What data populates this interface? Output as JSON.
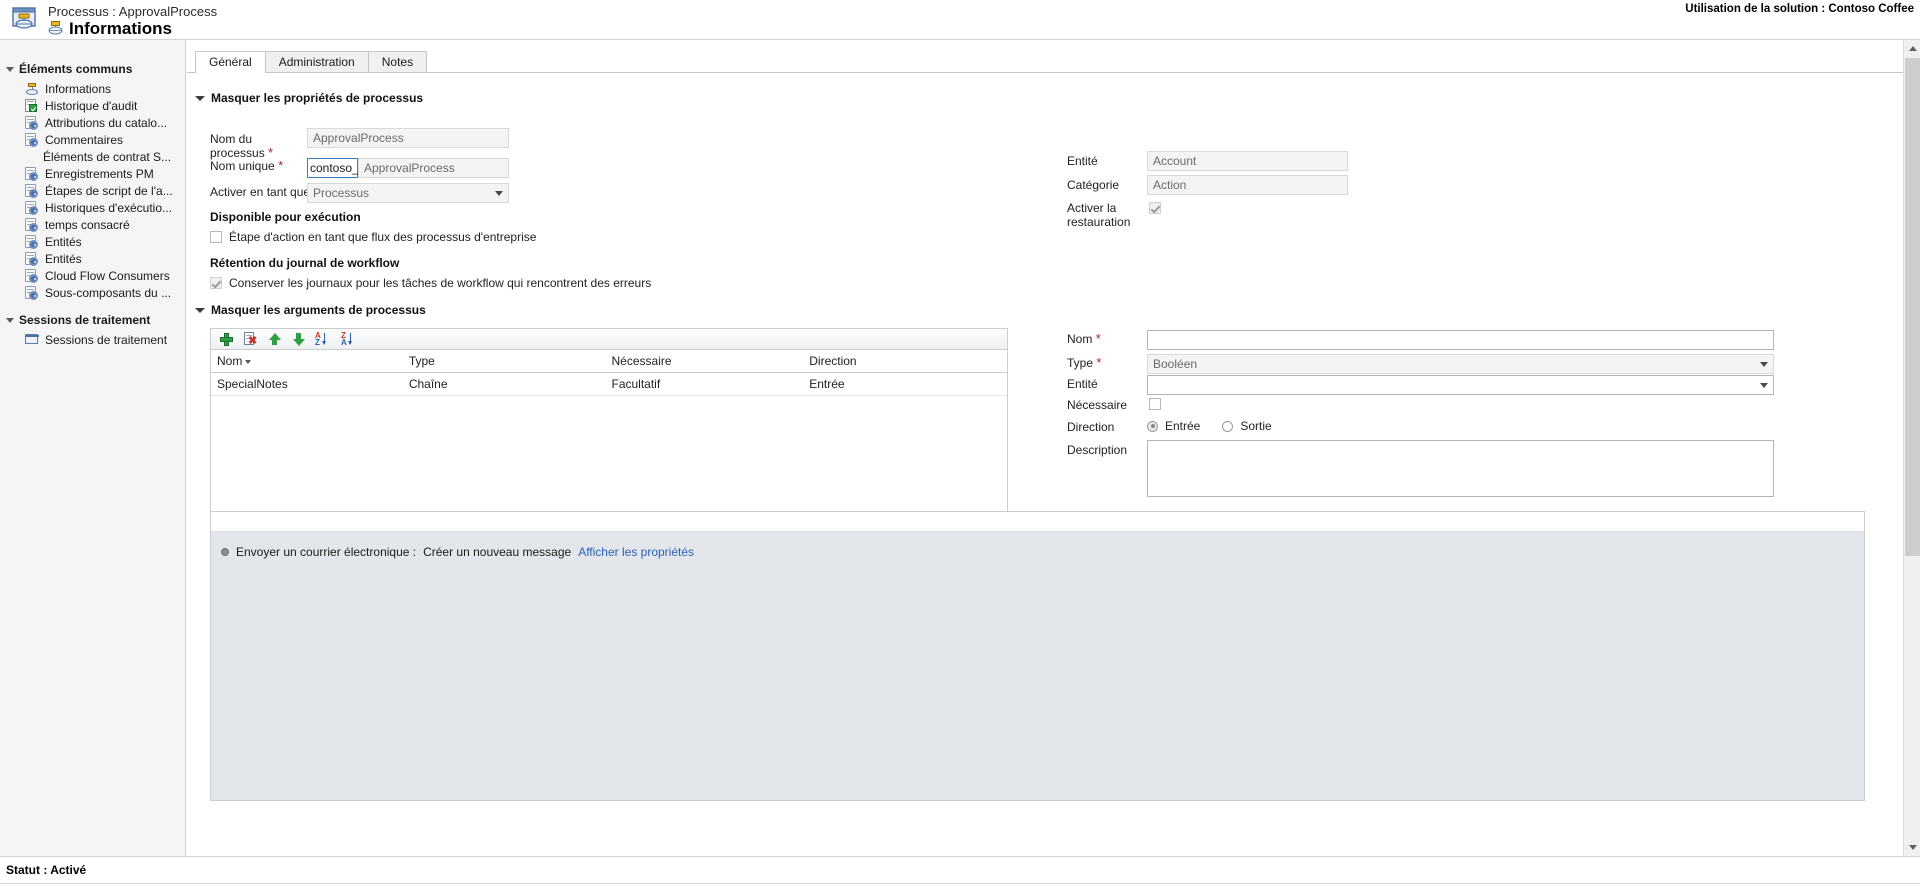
{
  "header": {
    "breadcrumb": "Processus : ApprovalProcess",
    "title": "Informations",
    "solution": "Utilisation de la solution : Contoso Coffee",
    "process_icon": "process-diagram-icon",
    "title_icon": "process-node-icon"
  },
  "sidebar": {
    "groups": [
      {
        "label": "Éléments communs",
        "items": [
          {
            "label": "Informations",
            "icon": "process-node-icon"
          },
          {
            "label": "Historique d'audit",
            "icon": "audit-history-icon"
          },
          {
            "label": "Attributions du catalo...",
            "icon": "component-gear-icon"
          },
          {
            "label": "Commentaires",
            "icon": "component-gear-icon"
          },
          {
            "label": "Éléments de contrat S...",
            "icon": "none"
          },
          {
            "label": "Enregistrements PM",
            "icon": "component-gear-icon"
          },
          {
            "label": "Étapes de script de l'a...",
            "icon": "component-gear-icon"
          },
          {
            "label": "Historiques d'exécutio...",
            "icon": "component-gear-icon"
          },
          {
            "label": "temps consacré",
            "icon": "component-gear-icon"
          },
          {
            "label": "Entités",
            "icon": "component-gear-icon"
          },
          {
            "label": "Entités",
            "icon": "component-gear-icon"
          },
          {
            "label": "Cloud Flow Consumers",
            "icon": "component-gear-icon"
          },
          {
            "label": "Sous-composants du ...",
            "icon": "component-gear-icon"
          }
        ]
      },
      {
        "label": "Sessions de traitement",
        "items": [
          {
            "label": "Sessions de traitement",
            "icon": "session-screen-icon"
          }
        ]
      }
    ]
  },
  "tabs": [
    {
      "label": "Général",
      "active": true
    },
    {
      "label": "Administration",
      "active": false
    },
    {
      "label": "Notes",
      "active": false
    }
  ],
  "properties_section": {
    "header": "Masquer les propriétés de processus",
    "fields": {
      "process_name_label": "Nom du processus",
      "process_name_value": "ApprovalProcess",
      "unique_name_label": "Nom unique",
      "unique_name_prefix": "contoso_",
      "unique_name_value": "ApprovalProcess",
      "activate_as_label": "Activer en tant que",
      "activate_as_value": "Processus",
      "entity_label": "Entité",
      "entity_value": "Account",
      "category_label": "Catégorie",
      "category_value": "Action",
      "rollback_label": "Activer la restauration",
      "rollback_checked": true
    },
    "available_for_run": {
      "header": "Disponible pour exécution",
      "checkbox_label": "Étape d'action en tant que flux des processus d'entreprise",
      "checked": false
    },
    "workflow_log_retention": {
      "header": "Rétention du journal de workflow",
      "checkbox_label": "Conserver les journaux pour les tâches de workflow qui rencontrent des erreurs",
      "checked": true
    }
  },
  "arguments_section": {
    "header": "Masquer les arguments de processus",
    "toolbar": [
      {
        "name": "add-argument-button",
        "icon": "plus-icon"
      },
      {
        "name": "delete-argument-button",
        "icon": "delete-document-icon"
      },
      {
        "name": "move-up-button",
        "icon": "arrow-up-icon"
      },
      {
        "name": "move-down-button",
        "icon": "arrow-down-icon"
      },
      {
        "name": "sort-ascending-button",
        "icon": "sort-az-icon"
      },
      {
        "name": "sort-descending-button",
        "icon": "sort-za-icon"
      }
    ],
    "columns": [
      "Nom",
      "Type",
      "Nécessaire",
      "Direction"
    ],
    "rows": [
      {
        "nom": "SpecialNotes",
        "type": "Chaîne",
        "necessaire": "Facultatif",
        "direction": "Entrée"
      }
    ],
    "detail": {
      "nom_label": "Nom",
      "nom_value": "",
      "type_label": "Type",
      "type_value": "Booléen",
      "entite_label": "Entité",
      "entite_value": "",
      "necessaire_label": "Nécessaire",
      "necessaire_checked": false,
      "direction_label": "Direction",
      "direction_options": [
        "Entrée",
        "Sortie"
      ],
      "direction_selected": "Entrée",
      "description_label": "Description",
      "description_value": ""
    }
  },
  "steps": {
    "items": [
      {
        "action": "Envoyer un courrier électronique :",
        "detail": "Créer un nouveau message",
        "link": "Afficher les propriétés"
      }
    ]
  },
  "status_bar": {
    "text": "Statut : Activé"
  }
}
